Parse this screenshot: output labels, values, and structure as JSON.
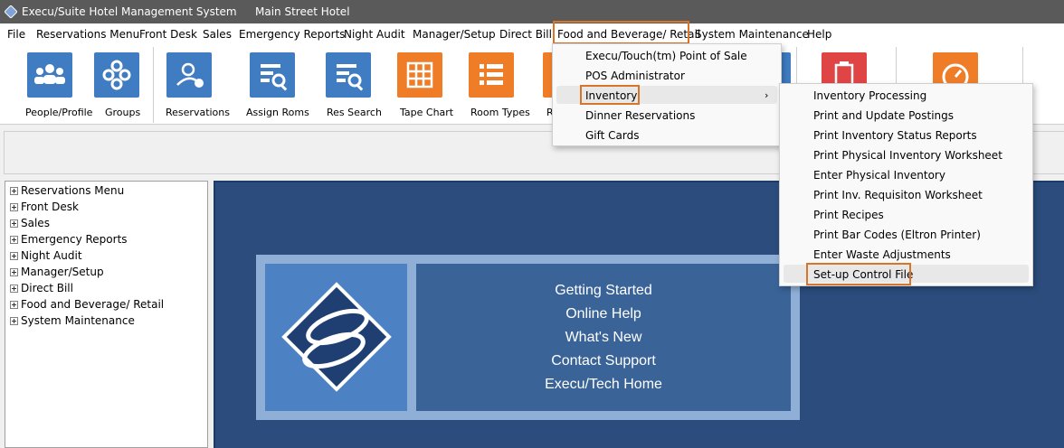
{
  "window": {
    "title": "Execu/Suite Hotel Management System",
    "hotel": "Main Street Hotel"
  },
  "menubar": [
    "File",
    "Reservations Menu",
    "Front Desk",
    "Sales",
    "Emergency Reports",
    "Night Audit",
    "Manager/Setup",
    "Direct Bill",
    "Food and Beverage/ Retail",
    "System Maintenance",
    "Help"
  ],
  "toolbar": [
    {
      "label": "People/Profile",
      "icon": "people-icon",
      "color": "#3f7cc2"
    },
    {
      "label": "Groups",
      "icon": "groups-icon",
      "color": "#3f7cc2"
    },
    {
      "label": "Reservations",
      "icon": "add-person-icon",
      "color": "#3f7cc2"
    },
    {
      "label": "Assign Roms",
      "icon": "search-list-icon",
      "color": "#3f7cc2"
    },
    {
      "label": "Res Search",
      "icon": "search-list-icon",
      "color": "#3f7cc2"
    },
    {
      "label": "Tape Chart",
      "icon": "grid-icon",
      "color": "#ef7d28"
    },
    {
      "label": "Room Types",
      "icon": "list-icon",
      "color": "#ef7d28"
    },
    {
      "label": "R",
      "icon": "partial-icon",
      "color": "#ef7d28"
    }
  ],
  "tree": [
    "Reservations Menu",
    "Front Desk",
    "Sales",
    "Emergency Reports",
    "Night Audit",
    "Manager/Setup",
    "Direct Bill",
    "Food and Beverage/ Retail",
    "System Maintenance"
  ],
  "panel_links": [
    "Getting Started",
    "Online Help",
    "What's New",
    "Contact Support",
    "Execu/Tech Home"
  ],
  "fb_menu": [
    "Execu/Touch(tm) Point of Sale",
    "POS Administrator",
    "Inventory",
    "Dinner Reservations",
    "Gift Cards"
  ],
  "inventory_menu": [
    "Inventory Processing",
    "Print and Update Postings",
    "Print Inventory Status Reports",
    "Print Physical Inventory Worksheet",
    "Enter Physical Inventory",
    "Print Inv. Requisiton Worksheet",
    "Print Recipes",
    "Print Bar Codes (Eltron Printer)",
    "Enter Waste Adjustments",
    "Set-up Control File"
  ],
  "colors": {
    "highlight": "#d9742b",
    "main_bg": "#2b4c7c",
    "titlebar": "#5a5a5a"
  }
}
